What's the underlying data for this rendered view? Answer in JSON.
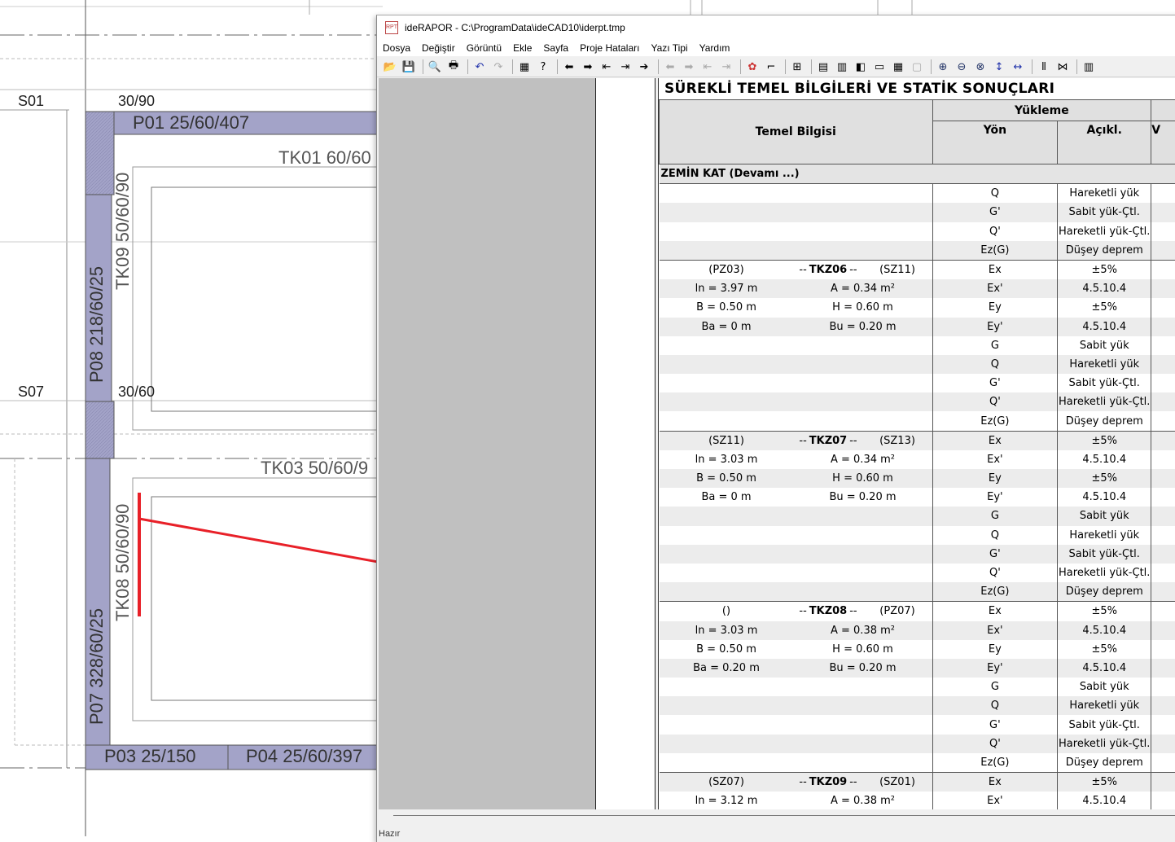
{
  "cad": {
    "labels": {
      "s01": "S01",
      "s07": "S07",
      "dim_30_90": "30/90",
      "dim_30_60": "30/60",
      "p01": "P01 25/60/407",
      "tk01": "TK01 60/60",
      "tk09": "TK09 50/60/90",
      "p08": "P08 218/60/25",
      "tk03": "TK03 50/60/9",
      "tk08": "TK08 50/60/90",
      "p07": "P07 328/60/25",
      "p03": "P03 25/150",
      "p04": "P04 25/60/397"
    },
    "annotation_color": "#e82028"
  },
  "window": {
    "title": "ideRAPOR - C:\\ProgramData\\ideCAD10\\iderpt.tmp",
    "icon": "ideRAPOR-app-icon",
    "menu": [
      "Dosya",
      "Değiştir",
      "Görüntü",
      "Ekle",
      "Sayfa",
      "Proje Hataları",
      "Yazı Tipi",
      "Yardım"
    ],
    "status": "Hazır"
  },
  "report": {
    "title": "SÜREKLİ TEMEL BİLGİLERİ VE STATİK SONUÇLARI",
    "headers": {
      "temel": "Temel Bilgisi",
      "yukleme": "Yükleme",
      "yon": "Yön",
      "aciklama": "Açıkl.",
      "next": "V"
    },
    "section": "ZEMİN KAT   (Devamı ...)",
    "pre_rows": [
      {
        "yon": "Q",
        "acik": "Hareketli yük"
      },
      {
        "yon": "G'",
        "acik": "Sabit yük-Çtl."
      },
      {
        "yon": "Q'",
        "acik": "Hareketli yük-Çtl."
      },
      {
        "yon": "Ez(G)",
        "acik": "Düşey deprem"
      }
    ],
    "groups": [
      {
        "left": "(PZ03)",
        "name": "TKZ06",
        "right": "(SZ11)",
        "ln": "ln = 3.97 m",
        "a": "A = 0.34 m²",
        "b": "B = 0.50 m",
        "h": "H = 0.60 m",
        "ba": "Ba = 0 m",
        "bu": "Bu = 0.20 m"
      },
      {
        "left": "(SZ11)",
        "name": "TKZ07",
        "right": "(SZ13)",
        "ln": "ln = 3.03 m",
        "a": "A = 0.34 m²",
        "b": "B = 0.50 m",
        "h": "H = 0.60 m",
        "ba": "Ba = 0 m",
        "bu": "Bu = 0.20 m"
      },
      {
        "left": "()",
        "name": "TKZ08",
        "right": "(PZ07)",
        "ln": "ln = 3.03 m",
        "a": "A = 0.38 m²",
        "b": "B = 0.50 m",
        "h": "H = 0.60 m",
        "ba": "Ba = 0.20 m",
        "bu": "Bu = 0.20 m"
      },
      {
        "left": "(SZ07)",
        "name": "TKZ09",
        "right": "(SZ01)",
        "ln": "ln = 3.12 m",
        "a": "A = 0.38 m²"
      }
    ],
    "load_rows": [
      {
        "yon": "Ex",
        "acik": "±5%"
      },
      {
        "yon": "Ex'",
        "acik": "4.5.10.4"
      },
      {
        "yon": "Ey",
        "acik": "±5%"
      },
      {
        "yon": "Ey'",
        "acik": "4.5.10.4"
      },
      {
        "yon": "G",
        "acik": "Sabit yük"
      },
      {
        "yon": "Q",
        "acik": "Hareketli yük"
      },
      {
        "yon": "G'",
        "acik": "Sabit yük-Çtl."
      },
      {
        "yon": "Q'",
        "acik": "Hareketli yük-Çtl."
      },
      {
        "yon": "Ez(G)",
        "acik": "Düşey deprem"
      }
    ],
    "dashes": "--"
  }
}
